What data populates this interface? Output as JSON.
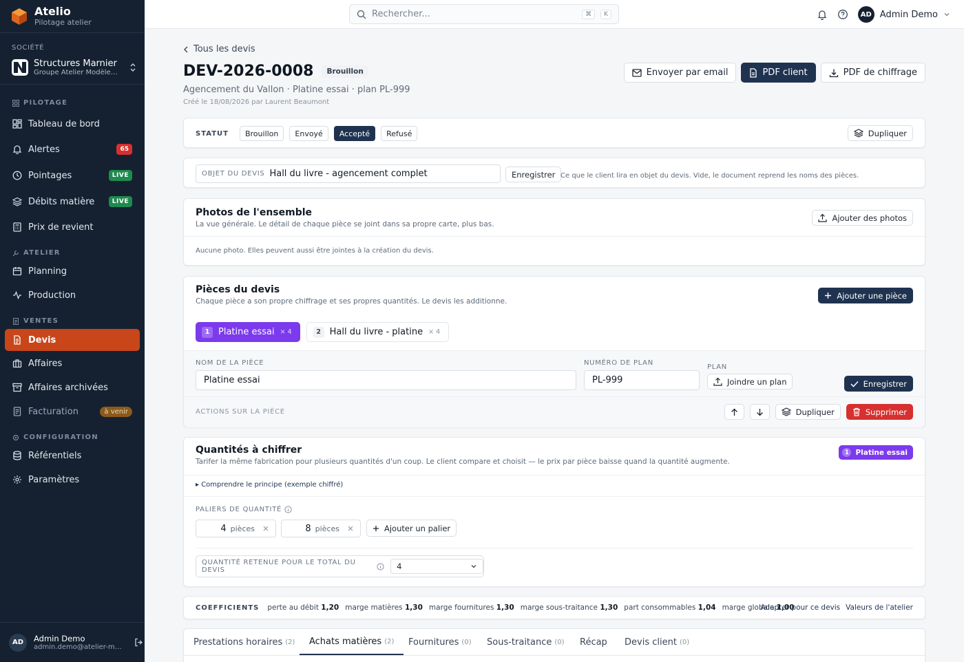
{
  "app": {
    "name": "Atelio",
    "subtitle": "Pilotage atelier"
  },
  "company": {
    "section_label": "SOCIÉTÉ",
    "name": "Structures Marnier",
    "group": "Groupe Atelier Modèle · Sarl"
  },
  "sidebar": {
    "sections": [
      {
        "label": "PILOTAGE"
      },
      {
        "label": "ATELIER"
      },
      {
        "label": "VENTES"
      },
      {
        "label": "CONFIGURATION"
      }
    ],
    "items": [
      {
        "label": "Tableau de bord"
      },
      {
        "label": "Alertes",
        "badge": "65"
      },
      {
        "label": "Pointages",
        "badge": "LIVE"
      },
      {
        "label": "Débits matière",
        "badge": "LIVE"
      },
      {
        "label": "Prix de revient"
      },
      {
        "label": "Planning"
      },
      {
        "label": "Production"
      },
      {
        "label": "Devis"
      },
      {
        "label": "Affaires"
      },
      {
        "label": "Affaires archivées"
      },
      {
        "label": "Facturation",
        "badge": "à venir"
      },
      {
        "label": "Référentiels"
      },
      {
        "label": "Paramètres"
      }
    ],
    "user": {
      "initials": "AD",
      "name": "Admin Demo",
      "email": "admin.demo@atelier-modele.fr"
    }
  },
  "topbar": {
    "search_placeholder": "Rechercher...",
    "kbd1": "⌘",
    "kbd2": "K",
    "user_initials": "AD",
    "user_name": "Admin Demo"
  },
  "page": {
    "back": "Tous les devis",
    "title": "DEV-2026-0008",
    "status_badge": "Brouillon",
    "subtitle": "Agencement du Vallon · Platine essai · plan PL-999",
    "created": "Créé le 18/08/2026 par Laurent Beaumont",
    "actions": {
      "email": "Envoyer par email",
      "pdf_client": "PDF client",
      "pdf_chiffrage": "PDF de chiffrage"
    }
  },
  "status": {
    "label": "STATUT",
    "options": [
      "Brouillon",
      "Envoyé",
      "Accepté",
      "Refusé"
    ],
    "selected": "Accepté",
    "duplicate": "Dupliquer"
  },
  "objet": {
    "label": "OBJET DU DEVIS",
    "value": "Hall du livre - agencement complet",
    "save": "Enregistrer",
    "hint": "Ce que le client lira en objet du devis. Vide, le document reprend les noms des pièces."
  },
  "photos": {
    "title": "Photos de l'ensemble",
    "subtitle": "La vue générale. Le détail de chaque pièce se joint dans sa propre carte, plus bas.",
    "add": "Ajouter des photos",
    "empty": "Aucune photo. Elles peuvent aussi être jointes à la création du devis."
  },
  "pieces": {
    "title": "Pièces du devis",
    "subtitle": "Chaque pièce a son propre chiffrage et ses propres quantités. Le devis les additionne.",
    "add": "Ajouter une pièce",
    "tabs": [
      {
        "num": "1",
        "name": "Platine essai",
        "qty": "× 4"
      },
      {
        "num": "2",
        "name": "Hall du livre - platine",
        "qty": "× 4"
      }
    ],
    "name_label": "NOM DE LA PIÈCE",
    "name_value": "Platine essai",
    "plan_num_label": "NUMÉRO DE PLAN",
    "plan_num_value": "PL-999",
    "plan_label": "PLAN",
    "join_plan": "Joindre un plan",
    "save": "Enregistrer",
    "actions_label": "ACTIONS SUR LA PIÈCE",
    "duplicate": "Dupliquer",
    "delete": "Supprimer"
  },
  "quantities": {
    "title": "Quantités à chiffrer",
    "subtitle": "Tarifer la même fabrication pour plusieurs quantités d'un coup. Le client compare et choisit — le prix par pièce baisse quand la quantité augmente.",
    "piece_badge_num": "1",
    "piece_badge": "Platine essai",
    "principle": "▸ Comprendre le principe (exemple chiffré)",
    "tiers_label": "PALIERS DE QUANTITÉ",
    "tiers": [
      {
        "value": "4",
        "unit": "pièces"
      },
      {
        "value": "8",
        "unit": "pièces"
      }
    ],
    "add_tier": "Ajouter un palier",
    "retained_label": "QUANTITÉ RETENUE POUR LE TOTAL DU DEVIS",
    "retained_value": "4"
  },
  "coefficients": {
    "label": "COEFFICIENTS",
    "items": [
      {
        "name": "perte au débit",
        "value": "1,20"
      },
      {
        "name": "marge matières",
        "value": "1,30"
      },
      {
        "name": "marge fournitures",
        "value": "1,30"
      },
      {
        "name": "marge sous-traitance",
        "value": "1,30"
      },
      {
        "name": "part consommables",
        "value": "1,04"
      },
      {
        "name": "marge globale",
        "value": "1,00"
      }
    ],
    "adapt": "Adapter pour ce devis",
    "defaults": "Valeurs de l'atelier"
  },
  "bottom_tabs": [
    {
      "label": "Prestations horaires",
      "count": "(2)"
    },
    {
      "label": "Achats matières",
      "count": "(2)"
    },
    {
      "label": "Fournitures",
      "count": "(0)"
    },
    {
      "label": "Sous-traitance",
      "count": "(0)"
    },
    {
      "label": "Récap",
      "count": ""
    },
    {
      "label": "Devis client",
      "count": "(0)"
    }
  ],
  "colors": {
    "sidebar": "#152130",
    "accent": "#c8461a",
    "primary": "#1f3350",
    "purple": "#7c3aed",
    "danger": "#d6302f"
  }
}
